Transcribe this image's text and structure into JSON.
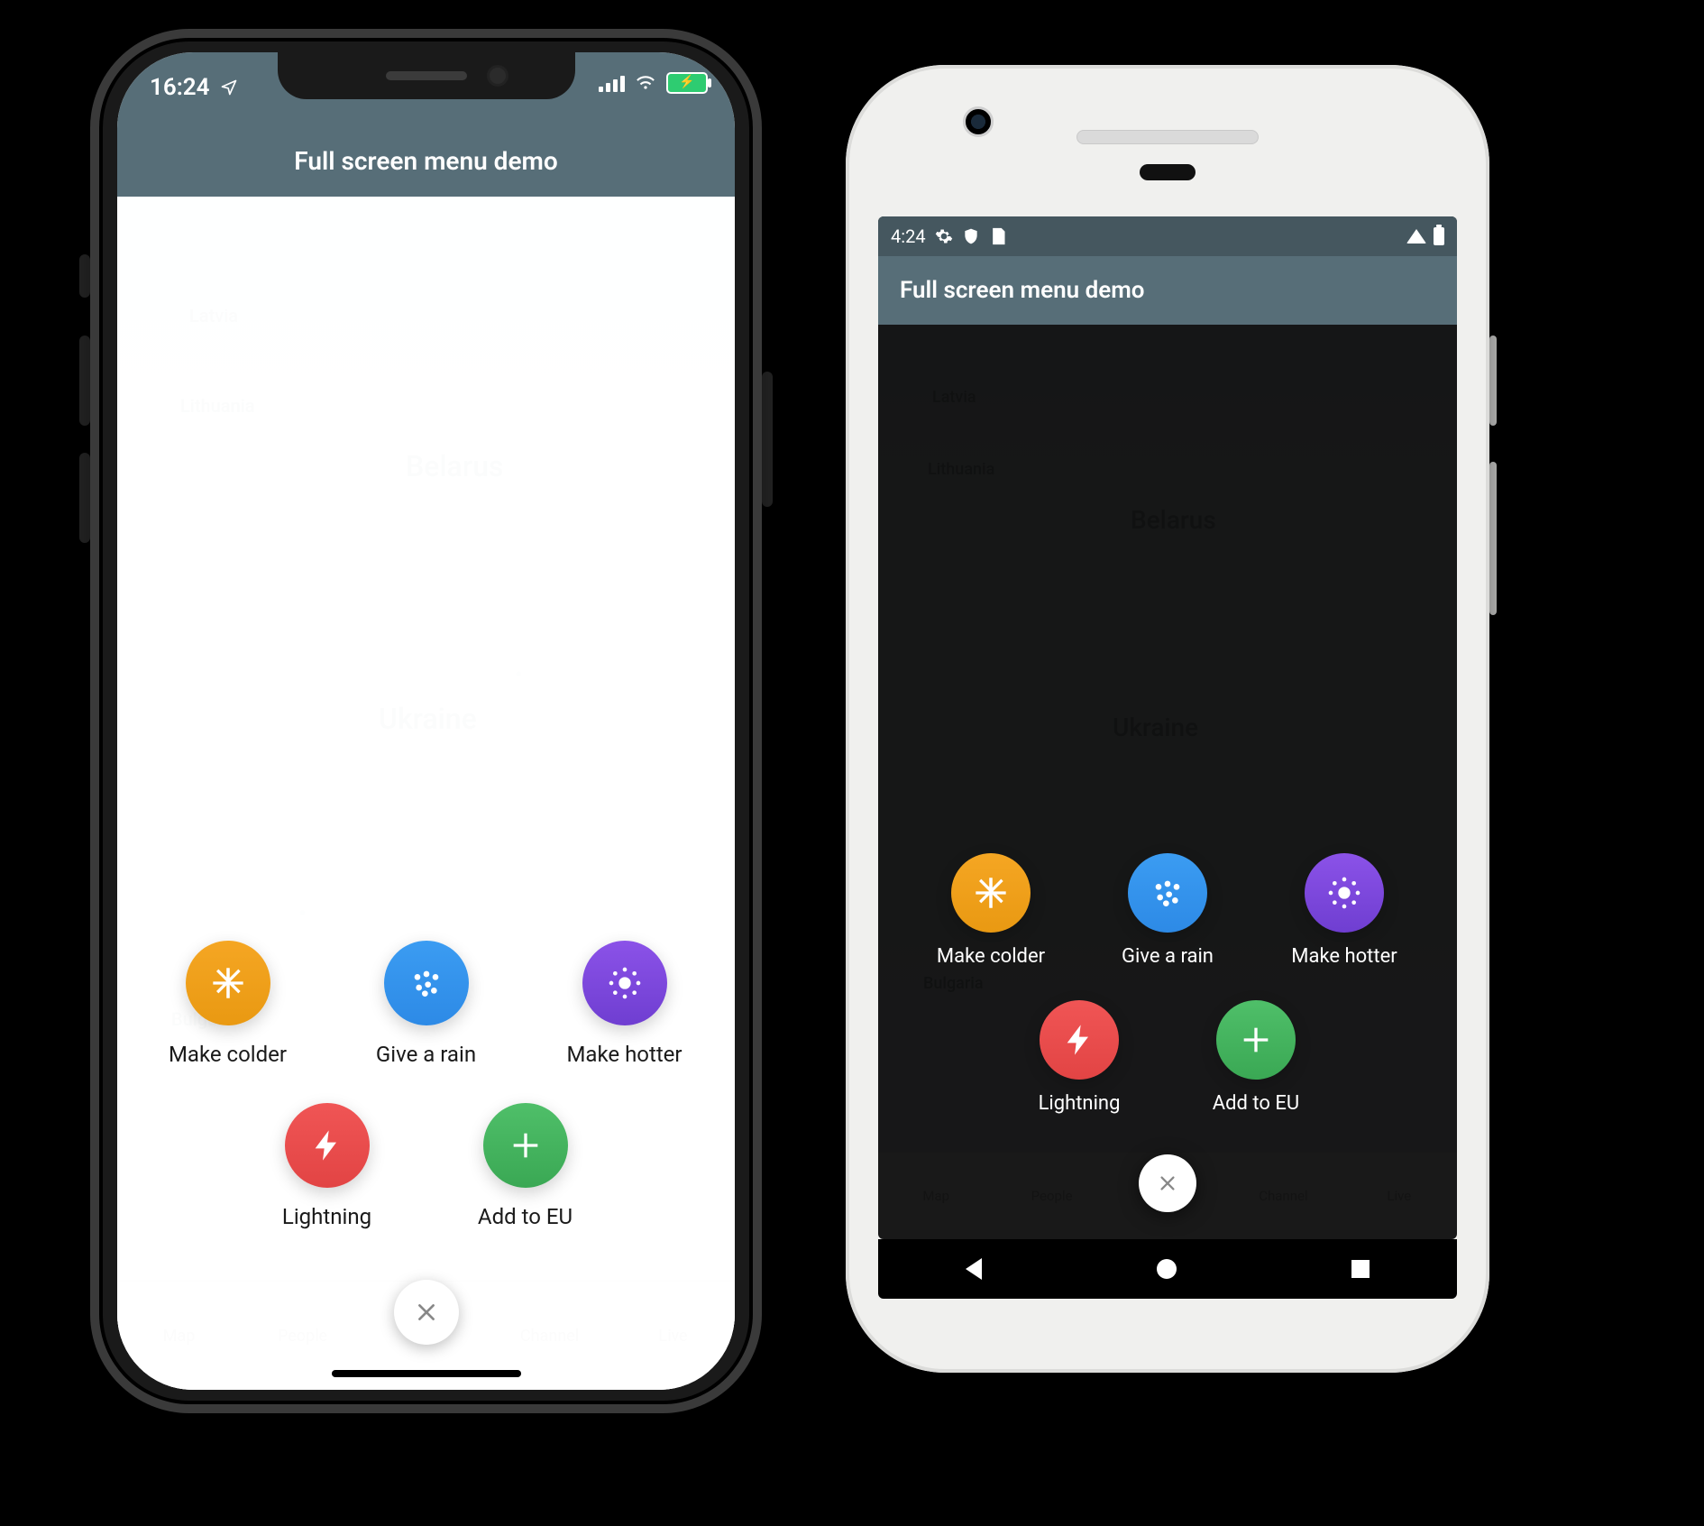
{
  "ios": {
    "status": {
      "time": "16:24"
    },
    "header": {
      "title": "Full screen menu demo"
    },
    "map_labels": {
      "latvia": "Latvia",
      "lithuania": "Lithuania",
      "belarus": "Belarus",
      "ukraine": "Ukraine",
      "bulgaria": "Bulgaria"
    },
    "tabs": [
      "Map",
      "People",
      "",
      "Channel",
      "Live"
    ],
    "menu": {
      "make_colder": "Make colder",
      "give_a_rain": "Give a rain",
      "make_hotter": "Make hotter",
      "lightning": "Lightning",
      "add_to_eu": "Add to EU"
    }
  },
  "android": {
    "status": {
      "time": "4:24"
    },
    "header": {
      "title": "Full screen menu demo"
    },
    "map_labels": {
      "latvia": "Latvia",
      "lithuania": "Lithuania",
      "belarus": "Belarus",
      "ukraine": "Ukraine",
      "bulgaria": "Bulgaria"
    },
    "tabs": [
      "Map",
      "People",
      "",
      "Channel",
      "Live"
    ],
    "menu": {
      "make_colder": "Make colder",
      "give_a_rain": "Give a rain",
      "make_hotter": "Make hotter",
      "lightning": "Lightning",
      "add_to_eu": "Add to EU"
    }
  },
  "colors": {
    "orange": "#f5a623",
    "blue": "#3b9cf2",
    "purple": "#8b52e8",
    "red": "#f05555",
    "green": "#4fbf69",
    "header": "#576e78"
  }
}
